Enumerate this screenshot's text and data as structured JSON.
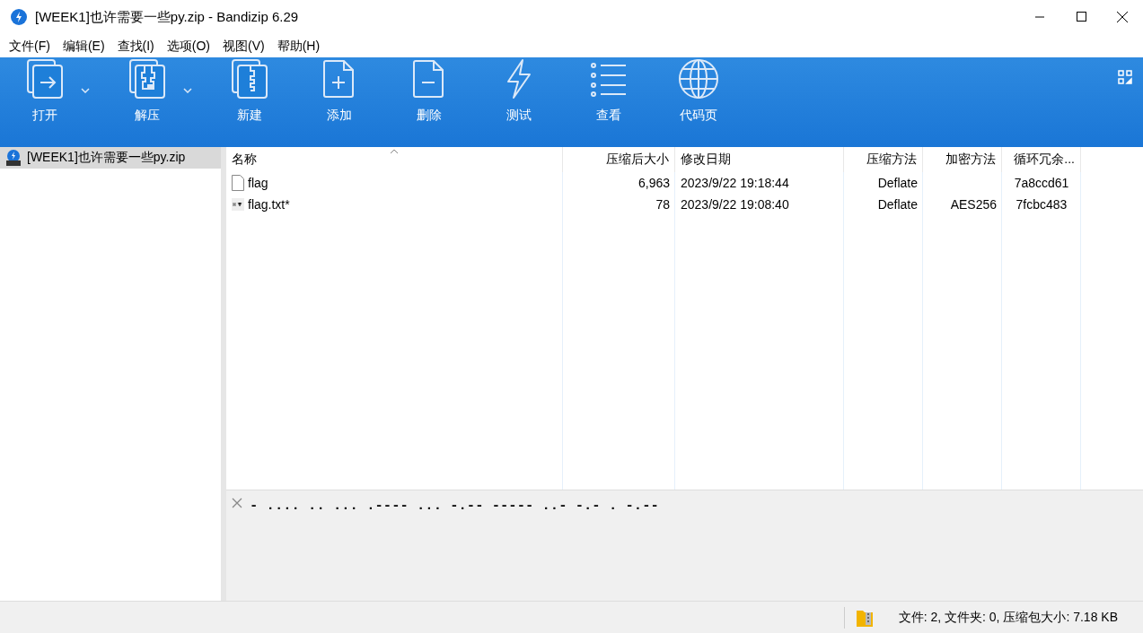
{
  "window": {
    "title": "[WEEK1]也许需要一些py.zip - Bandizip 6.29"
  },
  "menu": [
    "文件(F)",
    "编辑(E)",
    "查找(I)",
    "选项(O)",
    "视图(V)",
    "帮助(H)"
  ],
  "toolbar": [
    {
      "label": "打开",
      "dropdown": true
    },
    {
      "label": "解压",
      "dropdown": true
    },
    {
      "label": "新建",
      "dropdown": false
    },
    {
      "label": "添加",
      "dropdown": false
    },
    {
      "label": "删除",
      "dropdown": false
    },
    {
      "label": "测试",
      "dropdown": false
    },
    {
      "label": "查看",
      "dropdown": false
    },
    {
      "label": "代码页",
      "dropdown": false
    }
  ],
  "tree": [
    {
      "label": "[WEEK1]也许需要一些py.zip",
      "selected": true
    }
  ],
  "table": {
    "columns": [
      {
        "label": "名称",
        "sorted": true
      },
      {
        "label": "压缩后大小",
        "sorted": false
      },
      {
        "label": "修改日期",
        "sorted": false
      },
      {
        "label": "压缩方法",
        "sorted": false
      },
      {
        "label": "加密方法",
        "sorted": false
      },
      {
        "label": "循环冗余...",
        "sorted": false
      }
    ],
    "rows": [
      {
        "kind": "file",
        "cells": [
          "flag",
          "6,963",
          "2023/9/22 19:18:44",
          "Deflate",
          "",
          "7a8ccd61"
        ]
      },
      {
        "kind": "text",
        "cells": [
          "flag.txt*",
          "78",
          "2023/9/22 19:08:40",
          "Deflate",
          "AES256",
          "7fcbc483"
        ]
      }
    ]
  },
  "comment": "- .... .. ... .---- ... -.-- ----- ..- -.- . -.--",
  "status_bar": {
    "text": "文件: 2, 文件夹: 0, 压缩包大小: 7.18 KB"
  }
}
